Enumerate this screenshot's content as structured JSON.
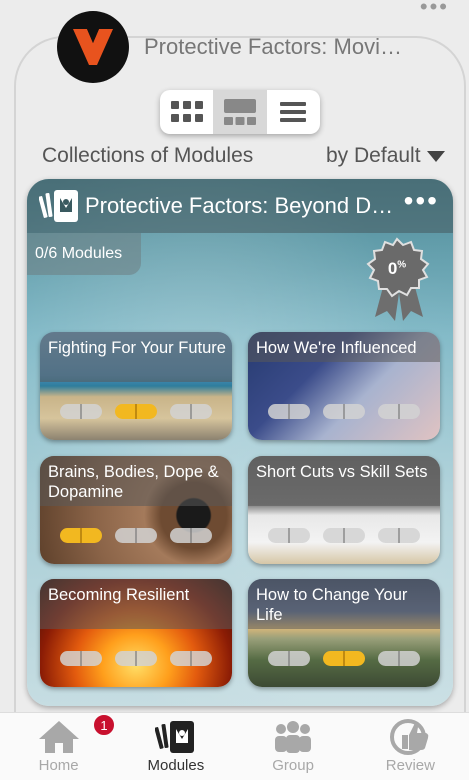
{
  "header": {
    "title": "Protective Factors: Movi…"
  },
  "view_toggle": {
    "options": [
      "grid",
      "cards",
      "list"
    ],
    "active": "cards"
  },
  "collections": {
    "label": "Collections of Modules",
    "sort_value": "by Default"
  },
  "collection_card": {
    "title": "Protective Factors: Beyond D…",
    "progress_text": "0/6 Modules",
    "badge_percent_value": "0",
    "badge_percent_sign": "%"
  },
  "modules": [
    {
      "title": "Fighting For Your Future",
      "progress": [
        false,
        true,
        false
      ]
    },
    {
      "title": "How We're Influenced",
      "progress": [
        false,
        false,
        false
      ]
    },
    {
      "title": "Brains, Bodies, Dope & Dopamine",
      "progress": [
        true,
        false,
        false
      ]
    },
    {
      "title": "Short Cuts vs Skill Sets",
      "progress": [
        false,
        false,
        false
      ]
    },
    {
      "title": "Becoming Resilient",
      "progress": [
        false,
        false,
        false
      ]
    },
    {
      "title": "How to Change Your Life",
      "progress": [
        false,
        true,
        false
      ]
    }
  ],
  "bottom_nav": {
    "items": [
      {
        "label": "Home",
        "icon": "home-icon"
      },
      {
        "label": "Modules",
        "icon": "modules-icon"
      },
      {
        "label": "Group",
        "icon": "group-icon"
      },
      {
        "label": "Review",
        "icon": "review-icon"
      }
    ],
    "active": "Modules",
    "home_badge": "1"
  },
  "colors": {
    "accent_yellow": "#f2b820",
    "notification_red": "#c8102e",
    "logo_orange": "#e8531e"
  }
}
